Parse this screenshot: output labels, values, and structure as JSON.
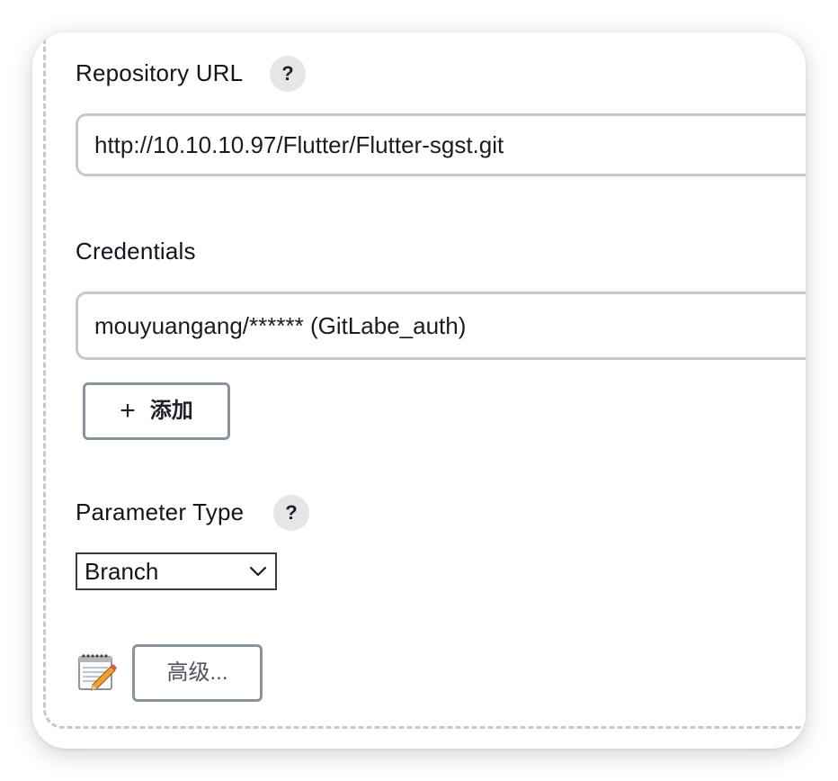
{
  "repository_url": {
    "label": "Repository URL",
    "help": "?",
    "value": "http://10.10.10.97/Flutter/Flutter-sgst.git"
  },
  "credentials": {
    "label": "Credentials",
    "value": "mouyuangang/****** (GitLabe_auth)",
    "add_button_icon": "plus-icon",
    "add_button_plus": "+",
    "add_button_label": "添加"
  },
  "parameter_type": {
    "label": "Parameter Type",
    "help": "?",
    "selected": "Branch"
  },
  "advanced": {
    "icon": "notepad-icon",
    "button_label": "高级..."
  },
  "colors": {
    "field_border": "#c3c9d1",
    "button_border": "#8a949f",
    "help_bg": "#e6e6e9",
    "dashed_border": "#c5c8cf"
  }
}
